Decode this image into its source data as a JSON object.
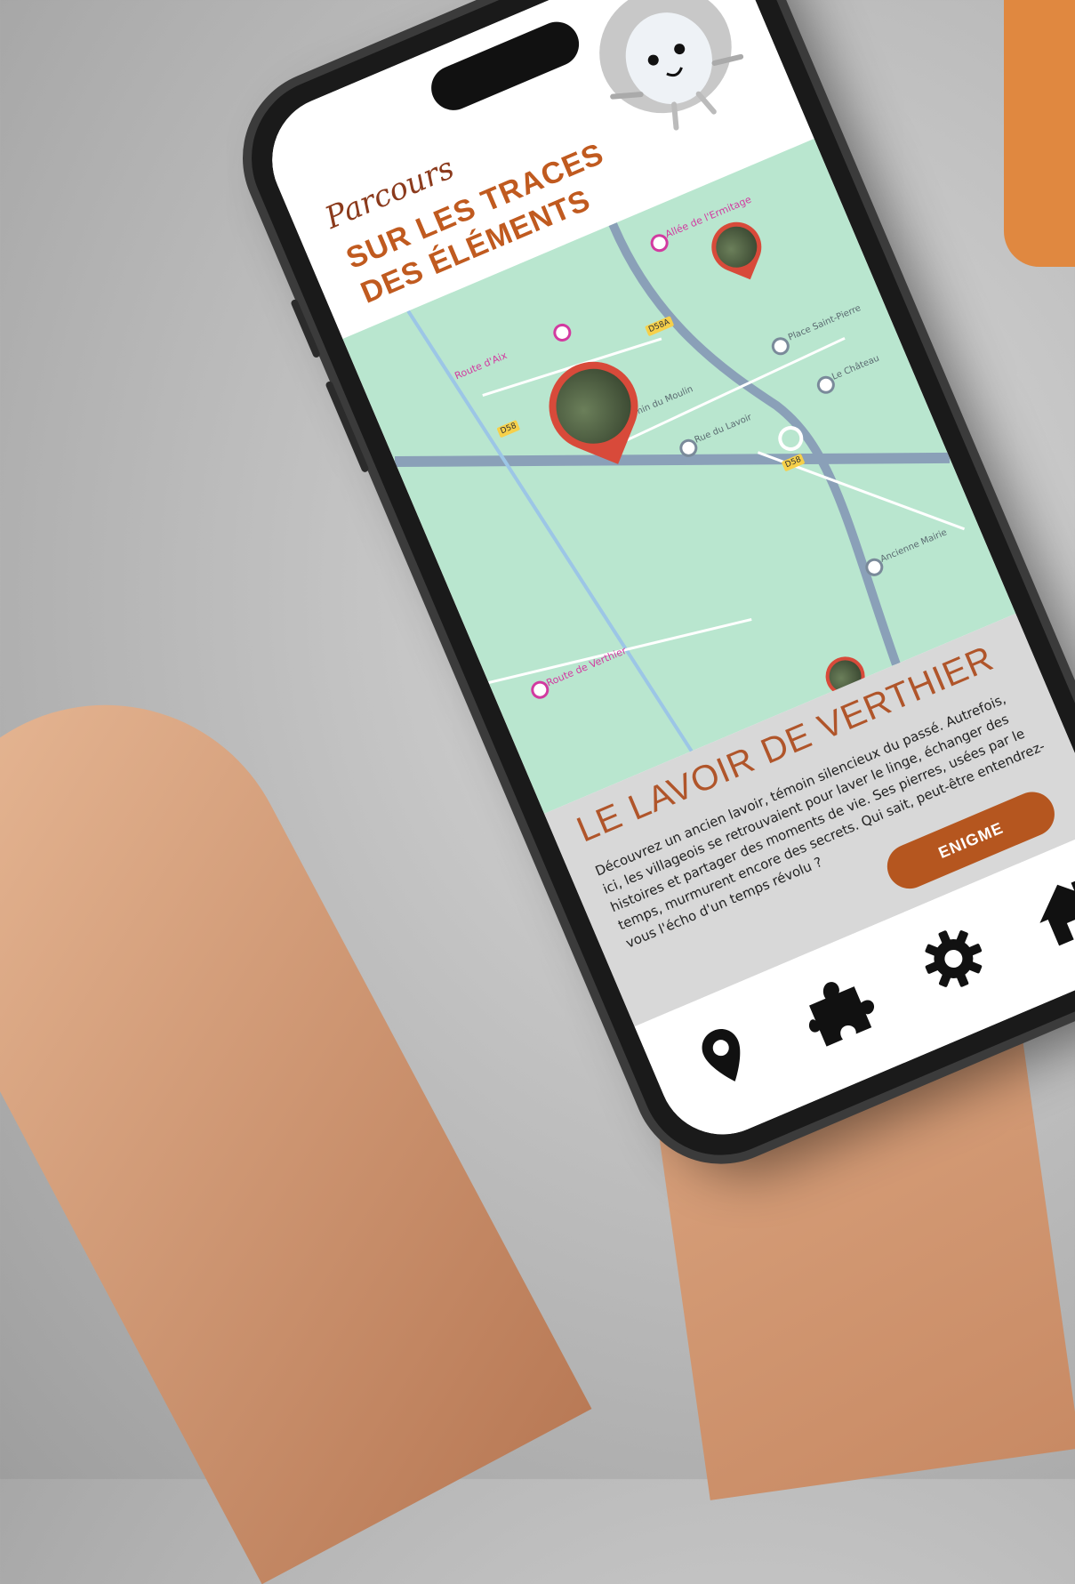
{
  "app": {
    "subtitle": "Parcours",
    "title": "SUR LES TRACES DES ÉLÉMENTS"
  },
  "map": {
    "road_tags": [
      "D58",
      "D58A",
      "D58"
    ],
    "place_labels": [
      "Allée de l'Ermitage",
      "Route d'Aix",
      "Chemin du Moulin",
      "Place Saint-Pierre",
      "Rue du Lavoir",
      "Le Château",
      "Route de Verthier",
      "Ancienne Mairie"
    ]
  },
  "poi": {
    "title": "LE LAVOIR DE VERTHIER",
    "description": "Découvrez un ancien lavoir, témoin silencieux du passé. Autrefois, ici, les villageois se retrouvaient pour laver le linge, échanger des histoires et partager des moments de vie. Ses pierres, usées par le temps, murmurent encore des secrets. Qui sait, peut-être entendrez-vous l'écho d'un temps révolu ?",
    "button": "ENIGME"
  },
  "navbar": {
    "items": [
      {
        "name": "map-pin-icon"
      },
      {
        "name": "puzzle-icon"
      },
      {
        "name": "gear-icon"
      },
      {
        "name": "home-icon"
      }
    ]
  },
  "colors": {
    "accent": "#c05a1f",
    "button": "#b5561f",
    "map_bg": "#b9e6cf",
    "pin": "#d84a3a"
  }
}
